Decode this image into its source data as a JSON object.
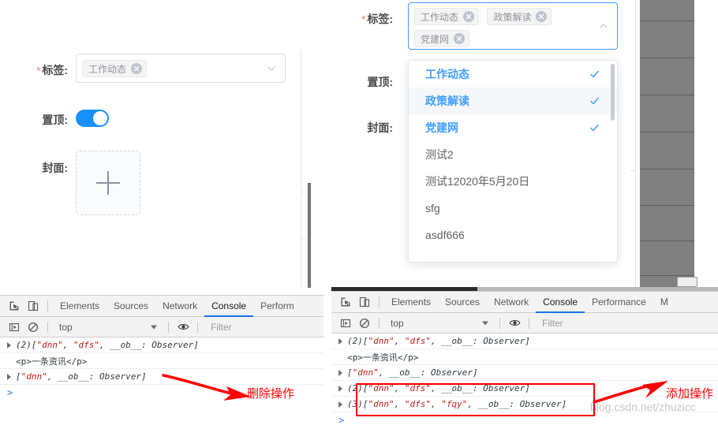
{
  "left_panel": {
    "form": {
      "tags_field": {
        "label": "标签:",
        "required_marker": "*",
        "chips": [
          {
            "text": "工作动态"
          }
        ],
        "caret_icon": "chevron-down-icon"
      },
      "pin_field": {
        "label": "置顶:",
        "switch_on": true
      },
      "cover_field": {
        "label": "封面:",
        "upload_icon": "plus-icon"
      }
    },
    "devtools": {
      "inspect_icon": "inspect-element-icon",
      "device_icon": "device-toolbar-icon",
      "tabs": [
        {
          "label": "Elements",
          "active": false
        },
        {
          "label": "Sources",
          "active": false
        },
        {
          "label": "Network",
          "active": false
        },
        {
          "label": "Console",
          "active": true
        },
        {
          "label": "Perform",
          "active": false
        }
      ],
      "filterbar": {
        "execute_icon": "execute-icon",
        "clear_icon": "clear-console-icon",
        "context": "top",
        "eye_icon": "eye-icon",
        "filter_placeholder": "Filter"
      },
      "console_rows": [
        {
          "expandable": true,
          "count": "(2)",
          "body": "[\"dnn\", \"dfs\", __ob__: Observer]",
          "strings": [
            "dnn",
            "dfs"
          ]
        },
        {
          "expandable": false,
          "count": "",
          "body": "<p>一条资讯</p>",
          "strings": []
        },
        {
          "expandable": true,
          "count": "",
          "body": "[\"dnn\", __ob__: Observer]",
          "strings": [
            "dnn"
          ]
        }
      ],
      "prompt": ">"
    },
    "annotation": {
      "text": "删除操作",
      "arrow_icon": "arrow-right-icon"
    }
  },
  "right_panel": {
    "form": {
      "tags_field": {
        "label": "标签:",
        "required_marker": "*",
        "chips": [
          {
            "text": "工作动态"
          },
          {
            "text": "政策解读"
          },
          {
            "text": "党建网"
          }
        ],
        "caret_icon": "chevron-up-icon"
      },
      "pin_field": {
        "label": "置顶:"
      },
      "cover_field": {
        "label": "封面:"
      }
    },
    "dropdown": {
      "items": [
        {
          "label": "工作动态",
          "selected": true,
          "hovered": false
        },
        {
          "label": "政策解读",
          "selected": true,
          "hovered": true
        },
        {
          "label": "党建网",
          "selected": true,
          "hovered": false
        },
        {
          "label": "测试2",
          "selected": false,
          "hovered": false
        },
        {
          "label": "测试12020年5月20日",
          "selected": false,
          "hovered": false
        },
        {
          "label": "sfg",
          "selected": false,
          "hovered": false
        },
        {
          "label": "asdf666",
          "selected": false,
          "hovered": false
        }
      ],
      "check_icon": "check-icon"
    },
    "devtools": {
      "inspect_icon": "inspect-element-icon",
      "device_icon": "device-toolbar-icon",
      "tabs": [
        {
          "label": "Elements",
          "active": false
        },
        {
          "label": "Sources",
          "active": false
        },
        {
          "label": "Network",
          "active": false
        },
        {
          "label": "Console",
          "active": true
        },
        {
          "label": "Performance",
          "active": false
        },
        {
          "label": "M",
          "active": false
        }
      ],
      "filterbar": {
        "execute_icon": "execute-icon",
        "clear_icon": "clear-console-icon",
        "context": "top",
        "eye_icon": "eye-icon",
        "filter_placeholder": "Filter"
      },
      "console_rows": [
        {
          "expandable": true,
          "count": "(2)",
          "body": "[\"dnn\", \"dfs\", __ob__: Observer]",
          "highlight": false
        },
        {
          "expandable": false,
          "count": "",
          "body": "<p>一条资讯</p>",
          "highlight": false
        },
        {
          "expandable": true,
          "count": "",
          "body": "[\"dnn\", __ob__: Observer]",
          "highlight": false
        },
        {
          "expandable": true,
          "count": "(2)",
          "body": "[\"dnn\", \"dfs\", __ob__: Observer]",
          "highlight": true
        },
        {
          "expandable": true,
          "count": "(3)",
          "body": "[\"dnn\", \"dfs\", \"fqy\", __ob__: Observer]",
          "highlight": true
        }
      ],
      "prompt": ">"
    },
    "annotation": {
      "text": "添加操作",
      "arrow_icon": "arrow-right-icon"
    }
  },
  "watermark": {
    "text": "blog.csdn.net/zhuzicc"
  },
  "colors": {
    "accent_blue": "#409eff",
    "switch_blue": "#1890ff",
    "annotation_red": "#ff0000",
    "chip_bg": "#f4f4f5",
    "chip_text": "#909399",
    "mask_gray": "#808080",
    "devtools_chrome": "#f3f3f3",
    "console_string": "#c41a16"
  }
}
